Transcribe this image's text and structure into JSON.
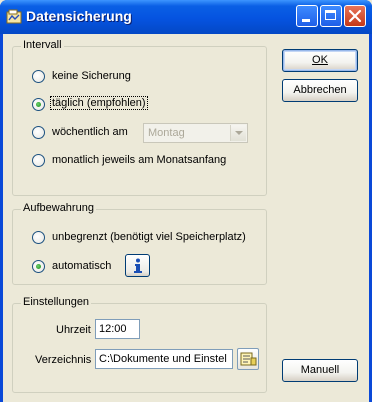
{
  "window": {
    "title": "Datensicherung",
    "controls": {
      "minimize": "minimize",
      "maximize": "maximize",
      "close": "close"
    }
  },
  "intervall": {
    "title": "Intervall",
    "options": [
      {
        "label": "keine Sicherung",
        "checked": false
      },
      {
        "label": "täglich (empfohlen)",
        "checked": true
      },
      {
        "label": "wöchentlich am",
        "checked": false
      },
      {
        "label": "monatlich jeweils am Monatsanfang",
        "checked": false
      }
    ],
    "weekday_select": {
      "value": "Montag",
      "disabled": true
    }
  },
  "aufbewahrung": {
    "title": "Aufbewahrung",
    "options": [
      {
        "label": "unbegrenzt (benötigt viel Speicherplatz)",
        "checked": false
      },
      {
        "label": "automatisch",
        "checked": true
      }
    ],
    "info_icon": "info-icon"
  },
  "einstellungen": {
    "title": "Einstellungen",
    "uhrzeit_label": "Uhrzeit",
    "uhrzeit_value": "12:00",
    "verzeichnis_label": "Verzeichnis",
    "verzeichnis_value": "C:\\Dokumente und Einstel",
    "browse_icon": "folder-browse-icon"
  },
  "buttons": {
    "ok": {
      "label": "OK",
      "mnemonic": "O"
    },
    "abbrechen": {
      "label": "Abbrechen",
      "mnemonic": "A"
    },
    "manuell": {
      "label": "Manuell",
      "mnemonic": "M"
    }
  },
  "colors": {
    "titlebar": "#0553E0",
    "dialog_bg": "#ECE9D8",
    "radio_dot": "#21A121",
    "info_icon": "#1B4FB5"
  }
}
